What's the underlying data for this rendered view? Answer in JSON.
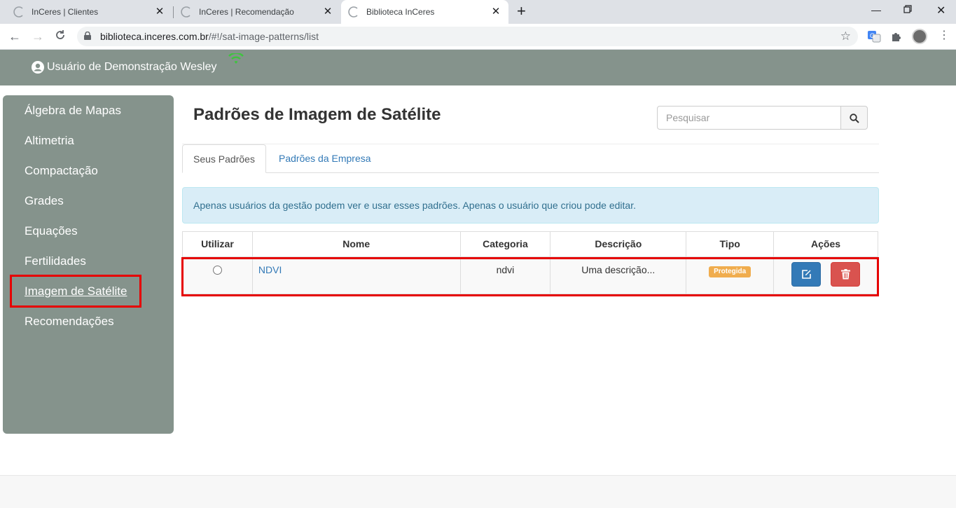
{
  "browser": {
    "tabs": [
      {
        "title": "InCeres | Clientes"
      },
      {
        "title": "InCeres | Recomendação"
      },
      {
        "title": "Biblioteca InCeres"
      }
    ],
    "url_host": "biblioteca.inceres.com.br",
    "url_path": "/#!/sat-image-patterns/list"
  },
  "header": {
    "user_name": "Usuário de Demonstração Wesley"
  },
  "sidebar": {
    "items": [
      {
        "label": "Álgebra de Mapas"
      },
      {
        "label": "Altimetria"
      },
      {
        "label": "Compactação"
      },
      {
        "label": "Grades"
      },
      {
        "label": "Equações"
      },
      {
        "label": "Fertilidades"
      },
      {
        "label": "Imagem de Satélite"
      },
      {
        "label": "Recomendações"
      }
    ],
    "active_index": 6
  },
  "main": {
    "title": "Padrões de Imagem de Satélite",
    "search_placeholder": "Pesquisar",
    "tabs": [
      {
        "label": "Seus Padrões"
      },
      {
        "label": "Padrões da Empresa"
      }
    ],
    "alert": "Apenas usuários da gestão podem ver e usar esses padrões. Apenas o usuário que criou pode editar.",
    "table": {
      "headers": [
        "Utilizar",
        "Nome",
        "Categoria",
        "Descrição",
        "Tipo",
        "Ações"
      ],
      "rows": [
        {
          "name": "NDVI",
          "category": "ndvi",
          "description": "Uma descrição...",
          "type": "Protegida"
        }
      ]
    }
  },
  "colors": {
    "header_bg": "#85938c",
    "link": "#337ab7",
    "badge_warning": "#f0ad4e",
    "edit_button": "#337ab7",
    "delete_button": "#d9534f",
    "highlight": "#e60000"
  }
}
